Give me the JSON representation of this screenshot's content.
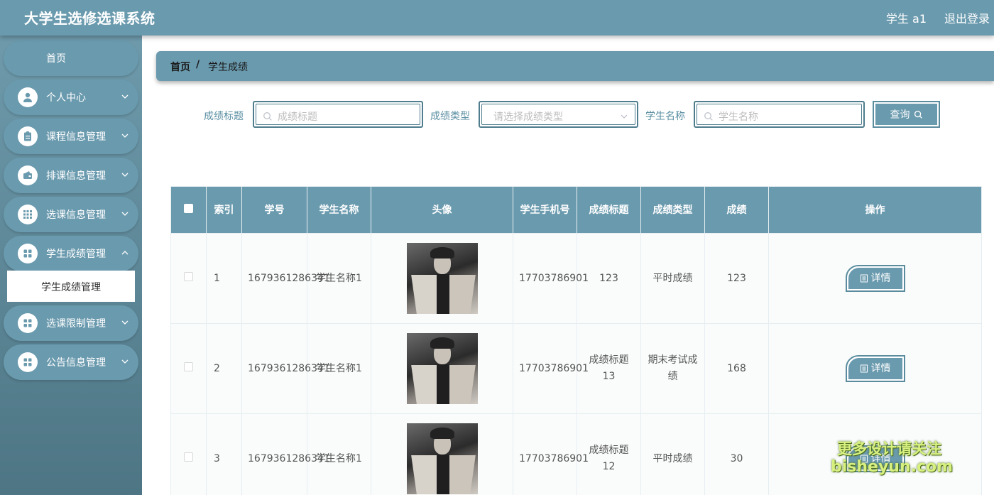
{
  "app": {
    "title": "大学生选修选课系统",
    "user": "学生 a1",
    "logout": "退出登录"
  },
  "sidebar": {
    "items": [
      {
        "label": "首页"
      },
      {
        "label": "个人中心"
      },
      {
        "label": "课程信息管理"
      },
      {
        "label": "排课信息管理"
      },
      {
        "label": "选课信息管理"
      },
      {
        "label": "学生成绩管理"
      },
      {
        "label": "选课限制管理"
      },
      {
        "label": "公告信息管理"
      }
    ],
    "submenu_active": "学生成绩管理"
  },
  "breadcrumb": {
    "home": "首页",
    "separator": "/",
    "current": "学生成绩"
  },
  "search": {
    "title_label": "成绩标题",
    "title_placeholder": "成绩标题",
    "type_label": "成绩类型",
    "type_placeholder": "请选择成绩类型",
    "student_label": "学生名称",
    "student_placeholder": "学生名称",
    "query_label": "查询"
  },
  "table": {
    "headers": [
      "索引",
      "学号",
      "学生名称",
      "头像",
      "学生手机号",
      "成绩标题",
      "成绩类型",
      "成绩",
      "操作"
    ],
    "rows": [
      {
        "index": "1",
        "student_no": "1679361286341",
        "student_name": "学生名称1",
        "phone": "17703786901",
        "title": "123",
        "type": "平时成绩",
        "score": "123",
        "action": "详情"
      },
      {
        "index": "2",
        "student_no": "1679361286341",
        "student_name": "学生名称1",
        "phone": "17703786901",
        "title": "成绩标题13",
        "type": "期末考试成绩",
        "score": "168",
        "action": "详情"
      },
      {
        "index": "3",
        "student_no": "1679361286341",
        "student_name": "学生名称1",
        "phone": "17703786901",
        "title": "成绩标题12",
        "type": "平时成绩",
        "score": "30",
        "action": "详情"
      }
    ]
  },
  "watermark": {
    "line1": "更多设计请关注",
    "line2": "bisheyun.com"
  },
  "colors": {
    "primary": "#6a9aae",
    "sidebar_dark": "#4d7584",
    "border": "#4f7d8d"
  }
}
